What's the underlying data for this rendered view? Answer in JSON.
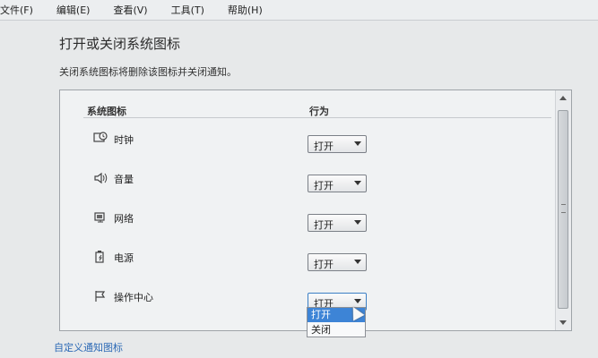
{
  "menu": [
    "文件(F)",
    "编辑(E)",
    "查看(V)",
    "工具(T)",
    "帮助(H)"
  ],
  "page": {
    "title": "打开或关闭系统图标",
    "description": "关闭系统图标将删除该图标并关闭通知。"
  },
  "table": {
    "header_icons": "系统图标",
    "header_behavior": "行为",
    "rows": [
      {
        "label": "时钟",
        "icon": "clock-icon",
        "value": "打开"
      },
      {
        "label": "音量",
        "icon": "volume-icon",
        "value": "打开"
      },
      {
        "label": "网络",
        "icon": "network-icon",
        "value": "打开"
      },
      {
        "label": "电源",
        "icon": "power-icon",
        "value": "打开"
      },
      {
        "label": "操作中心",
        "icon": "action-center-flag-icon",
        "value": "打开"
      }
    ]
  },
  "dropdown": {
    "options": [
      "打开",
      "关闭"
    ],
    "selected": "打开"
  },
  "footer": {
    "link": "自定义通知图标"
  }
}
